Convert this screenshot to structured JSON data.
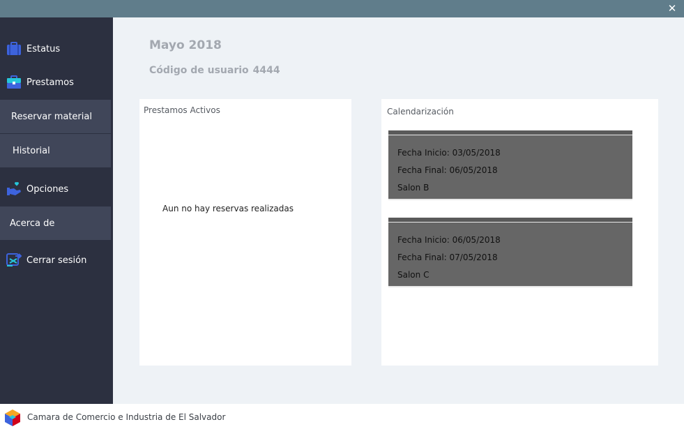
{
  "window": {
    "close_glyph": "✕"
  },
  "sidebar": {
    "items": [
      {
        "label": "Estatus",
        "icon": "briefcase-icon"
      },
      {
        "label": "Prestamos",
        "icon": "toolbox-icon"
      },
      {
        "label": "Reservar material"
      },
      {
        "label": "Historial"
      },
      {
        "label": "Opciones",
        "icon": "hand-heart-icon"
      },
      {
        "label": "Acerca de"
      },
      {
        "label": "Cerrar sesión",
        "icon": "logout-icon"
      }
    ]
  },
  "header": {
    "month": "Mayo 2018",
    "user_code_label": "Código de usuario",
    "user_code": "4444"
  },
  "active_loans": {
    "title": "Prestamos Activos",
    "empty_message": "Aun no hay reservas realizadas"
  },
  "calendar": {
    "title": "Calendarización",
    "reservations": [
      {
        "start": "Fecha Inicio: 03/05/2018",
        "end": "Fecha Final: 06/05/2018",
        "room": "Salon B"
      },
      {
        "start": "Fecha Inicio: 06/05/2018",
        "end": "Fecha Final: 07/05/2018",
        "room": "Salon C"
      }
    ]
  },
  "footer": {
    "org_name": "Camara de Comercio e Industria de El Salvador",
    "logo": "cube-logo-icon"
  },
  "colors": {
    "accent": "#3d63dd",
    "teal": "#26c6da",
    "sidebar_bg": "#2c3040",
    "card_bg": "#666666"
  }
}
